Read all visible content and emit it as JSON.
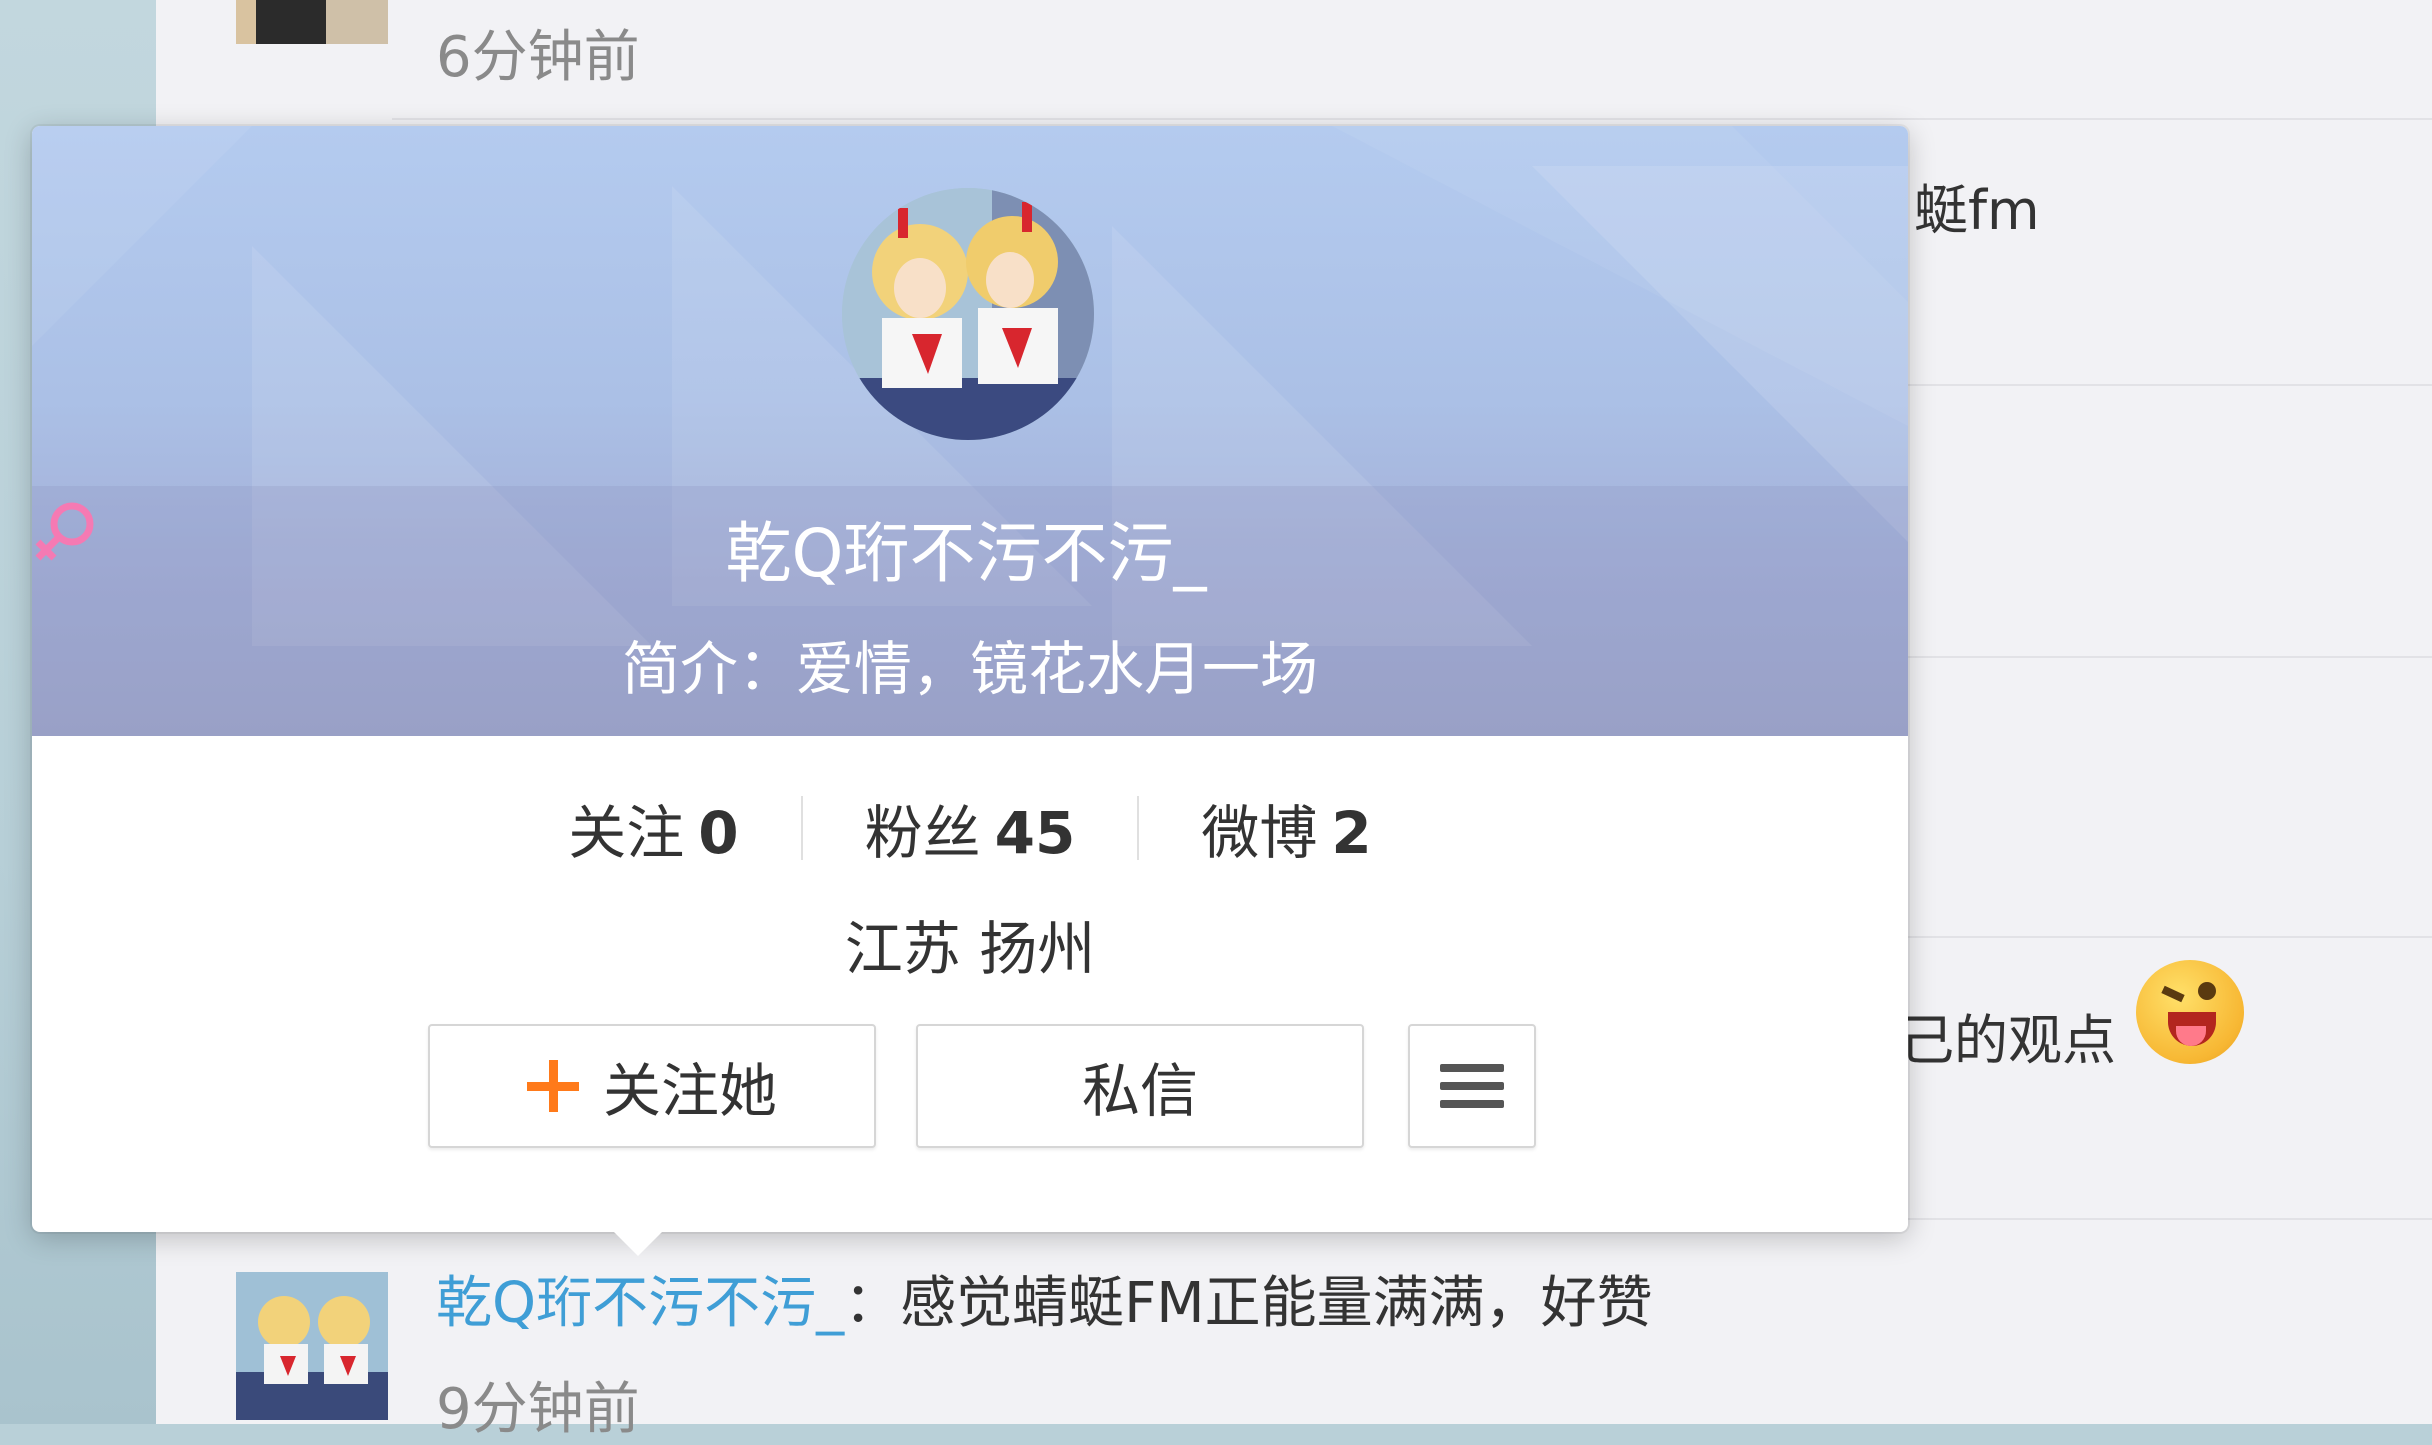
{
  "background_feed": {
    "top_time": "6分钟前",
    "right_snippet_1": "蜓fm",
    "right_snippet_2": "己的观点",
    "bottom_comment": {
      "author": "乾Q珩不污不污_",
      "separator": "：",
      "text": "感觉蜻蜓FM正能量满满，好赞",
      "time": "9分钟前"
    }
  },
  "profile_card": {
    "name": "乾Q珩不污不污_",
    "gender_icon": "female-icon",
    "bio": "简介：爱情，镜花水月一场",
    "stats": [
      {
        "label": "关注",
        "value": "0"
      },
      {
        "label": "粉丝",
        "value": "45"
      },
      {
        "label": "微博",
        "value": "2"
      }
    ],
    "location": "江苏 扬州",
    "follow_button": "关注她",
    "message_button": "私信",
    "more_button_icon": "menu-icon"
  },
  "colors": {
    "accent_plus": "#ff7a1a",
    "link_blue": "#3f9ed6",
    "gender_pink": "#f57ab3"
  }
}
